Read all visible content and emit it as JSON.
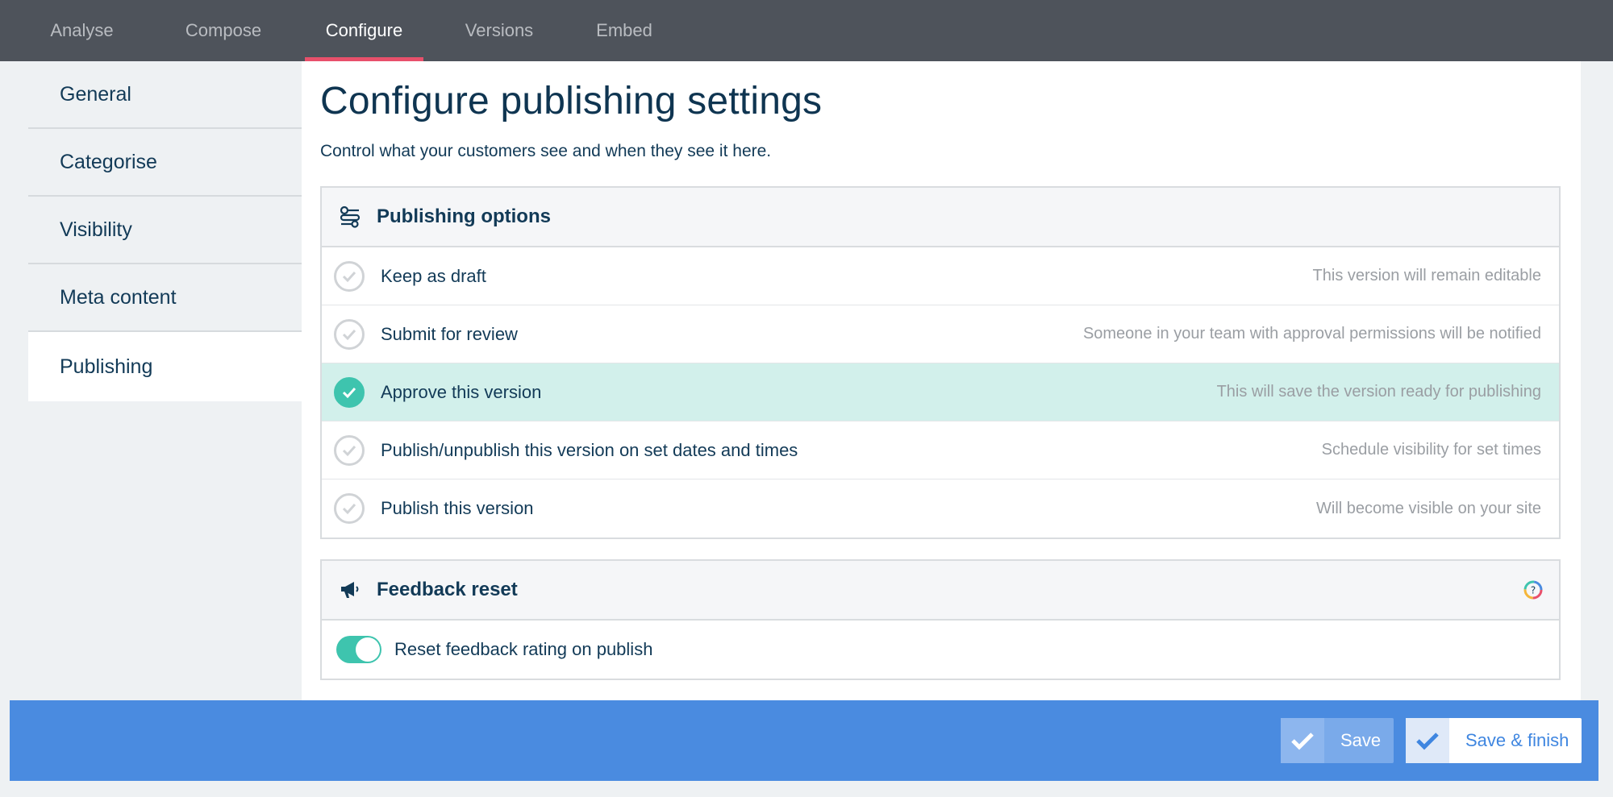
{
  "topnav": {
    "tabs": [
      {
        "label": "Analyse"
      },
      {
        "label": "Compose"
      },
      {
        "label": "Configure"
      },
      {
        "label": "Versions"
      },
      {
        "label": "Embed"
      }
    ],
    "active": "Configure",
    "accent_color": "#e8506b"
  },
  "sidebar": {
    "items": [
      {
        "label": "General"
      },
      {
        "label": "Categorise"
      },
      {
        "label": "Visibility"
      },
      {
        "label": "Meta content"
      },
      {
        "label": "Publishing"
      }
    ],
    "active": "Publishing"
  },
  "main": {
    "title": "Configure publishing settings",
    "subtitle": "Control what your customers see and when they see it here.",
    "publishing_options": {
      "heading": "Publishing options",
      "icon": "sliders-icon",
      "options": [
        {
          "label": "Keep as draft",
          "desc": "This version will remain editable",
          "selected": false
        },
        {
          "label": "Submit for review",
          "desc": "Someone in your team with approval permissions will be notified",
          "selected": false
        },
        {
          "label": "Approve this version",
          "desc": "This will save the version ready for publishing",
          "selected": true
        },
        {
          "label": "Publish/unpublish this version on set dates and times",
          "desc": "Schedule visibility for set times",
          "selected": false
        },
        {
          "label": "Publish this version",
          "desc": "Will become visible on your site",
          "selected": false
        }
      ],
      "selected_color": "#3ec4ae"
    },
    "feedback_reset": {
      "heading": "Feedback reset",
      "icon": "megaphone-icon",
      "help_icon": "help-icon",
      "toggle_label": "Reset feedback rating on publish",
      "toggle_on": true
    }
  },
  "footer": {
    "save_label": "Save",
    "finish_label": "Save & finish",
    "bar_color": "#4a8be0"
  }
}
